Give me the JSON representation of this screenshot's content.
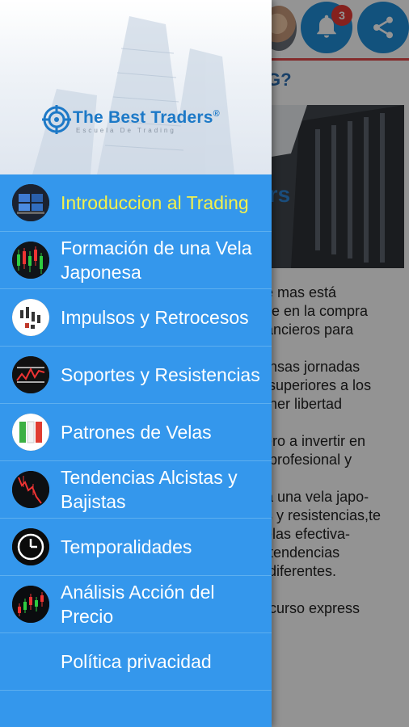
{
  "background": {
    "badge_count": "3",
    "heading": "G?",
    "image_text": "ders",
    "paragraph_lines": [
      "ue mas está",
      "iste en la compra",
      "nancieros para",
      "",
      "tensas jornadas",
      "s superiores a los",
      "tener libertad",
      "",
      "cero a invertir en",
      "a profesional y",
      "",
      "na una vela japo-",
      "es y resistencias,te",
      "velas efectiva-",
      "n tendencias",
      "s diferentes.",
      "",
      "n curso express"
    ],
    "icons": {
      "bell": "bell-icon",
      "share": "share-icon",
      "avatar": "avatar"
    },
    "colors": {
      "accent_blue": "#1f8ed8",
      "badge_red": "#e53935",
      "topbar_line": "#e24a4a"
    }
  },
  "drawer": {
    "logo_title": "The Best Traders",
    "logo_registered": "®",
    "logo_subtitle": "Escuela De Trading",
    "colors": {
      "background": "#3497ec",
      "active_text": "#f4f14c",
      "text": "#ffffff"
    },
    "items": [
      {
        "label": "Introduccion al Trading",
        "icon": "trading-desk-icon",
        "active": true
      },
      {
        "label": "Formación de una Vela Japonesa",
        "icon": "candlestick-chart-icon",
        "active": false
      },
      {
        "label": "Impulsos y Retrocesos",
        "icon": "impulse-chart-icon",
        "active": false
      },
      {
        "label": "Soportes y Resistencias",
        "icon": "support-resistance-chart-icon",
        "active": false
      },
      {
        "label": "Patrones de Velas",
        "icon": "candle-patterns-icon",
        "active": false
      },
      {
        "label": "Tendencias Alcistas y Bajistas",
        "icon": "trend-chart-icon",
        "active": false
      },
      {
        "label": "Temporalidades",
        "icon": "clock-icon",
        "active": false
      },
      {
        "label": "Análisis Acción del Precio",
        "icon": "price-action-icon",
        "active": false
      },
      {
        "label": "Política privacidad",
        "icon": "",
        "active": false
      }
    ]
  }
}
